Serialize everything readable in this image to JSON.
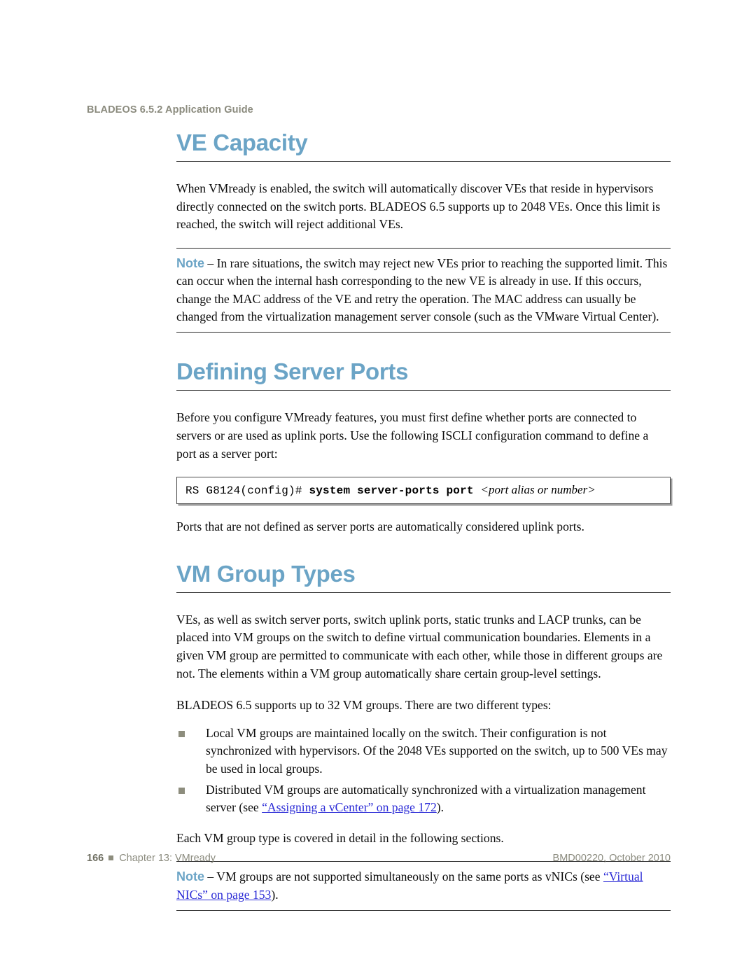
{
  "header": {
    "running_title": "BLADEOS 6.5.2 Application Guide"
  },
  "sections": [
    {
      "id": "ve-capacity",
      "title": "VE Capacity",
      "paragraph": "When VMready is enabled, the switch will automatically discover VEs that reside in hypervisors directly connected on the switch ports. BLADEOS 6.5 supports up to 2048 VEs. Once this limit is reached, the switch will reject additional VEs."
    },
    {
      "id": "defining-server-ports",
      "title": "Defining Server Ports",
      "paragraph": "Before you configure VMready features, you must first define whether ports are connected to servers or are used as uplink ports. Use the following ISCLI configuration command to define a port as a server port:",
      "trailing_paragraph": "Ports that are not defined as server ports are automatically considered uplink ports."
    },
    {
      "id": "vm-group-types",
      "title": "VM Group Types",
      "paragraph": "VEs, as well as switch server ports, switch uplink ports, static trunks and LACP trunks, can be placed into VM groups on the switch to define virtual communication boundaries. Elements in a given VM group are permitted to communicate with each other, while those in different groups are not. The elements within a VM group automatically share certain group-level settings.",
      "paragraph2": "BLADEOS 6.5 supports up to 32 VM groups. There are two different types:",
      "closing_paragraph": "Each VM group type is covered in detail in the following sections."
    }
  ],
  "notes": [
    {
      "id": "note-ve-capacity",
      "label": "Note",
      "dash": " – ",
      "text": "In rare situations, the switch may reject new VEs prior to reaching the supported limit. This can occur when the internal hash corresponding to the new VE is already in use. If this occurs, change the MAC address of the VE and retry the operation. The MAC address can usually be changed from the virtualization management server console (such as the VMware Virtual Center)."
    },
    {
      "id": "note-vm-groups",
      "label": "Note",
      "dash": " – ",
      "text_before_link": "VM groups are not supported simultaneously on the same ports as vNICs (see ",
      "link_text": "“Virtual NICs” on page 153",
      "text_after_link": ")."
    }
  ],
  "code_block": {
    "prompt": "RS G8124(config)#",
    "command": "system server-ports port",
    "argument": "<port alias or number>"
  },
  "bullets": [
    {
      "text": "Local VM groups are maintained locally on the switch. Their configuration is not synchronized with hypervisors. Of the 2048 VEs supported on the switch, up to 500 VEs may be used in local groups."
    },
    {
      "text_before_link": "Distributed VM groups are automatically synchronized with a virtualization management server (see ",
      "link_text": "“Assigning a vCenter” on page 172",
      "text_after_link": ")."
    }
  ],
  "footer": {
    "page_number": "166",
    "chapter": "Chapter 13: VMready",
    "doc_id": "BMD00220, October 2010"
  },
  "colors": {
    "heading_blue": "#6ba4c6",
    "header_gray": "#8b8b7e",
    "link_blue": "#2a2ad6",
    "bullet_square": "#8d8d7d"
  }
}
